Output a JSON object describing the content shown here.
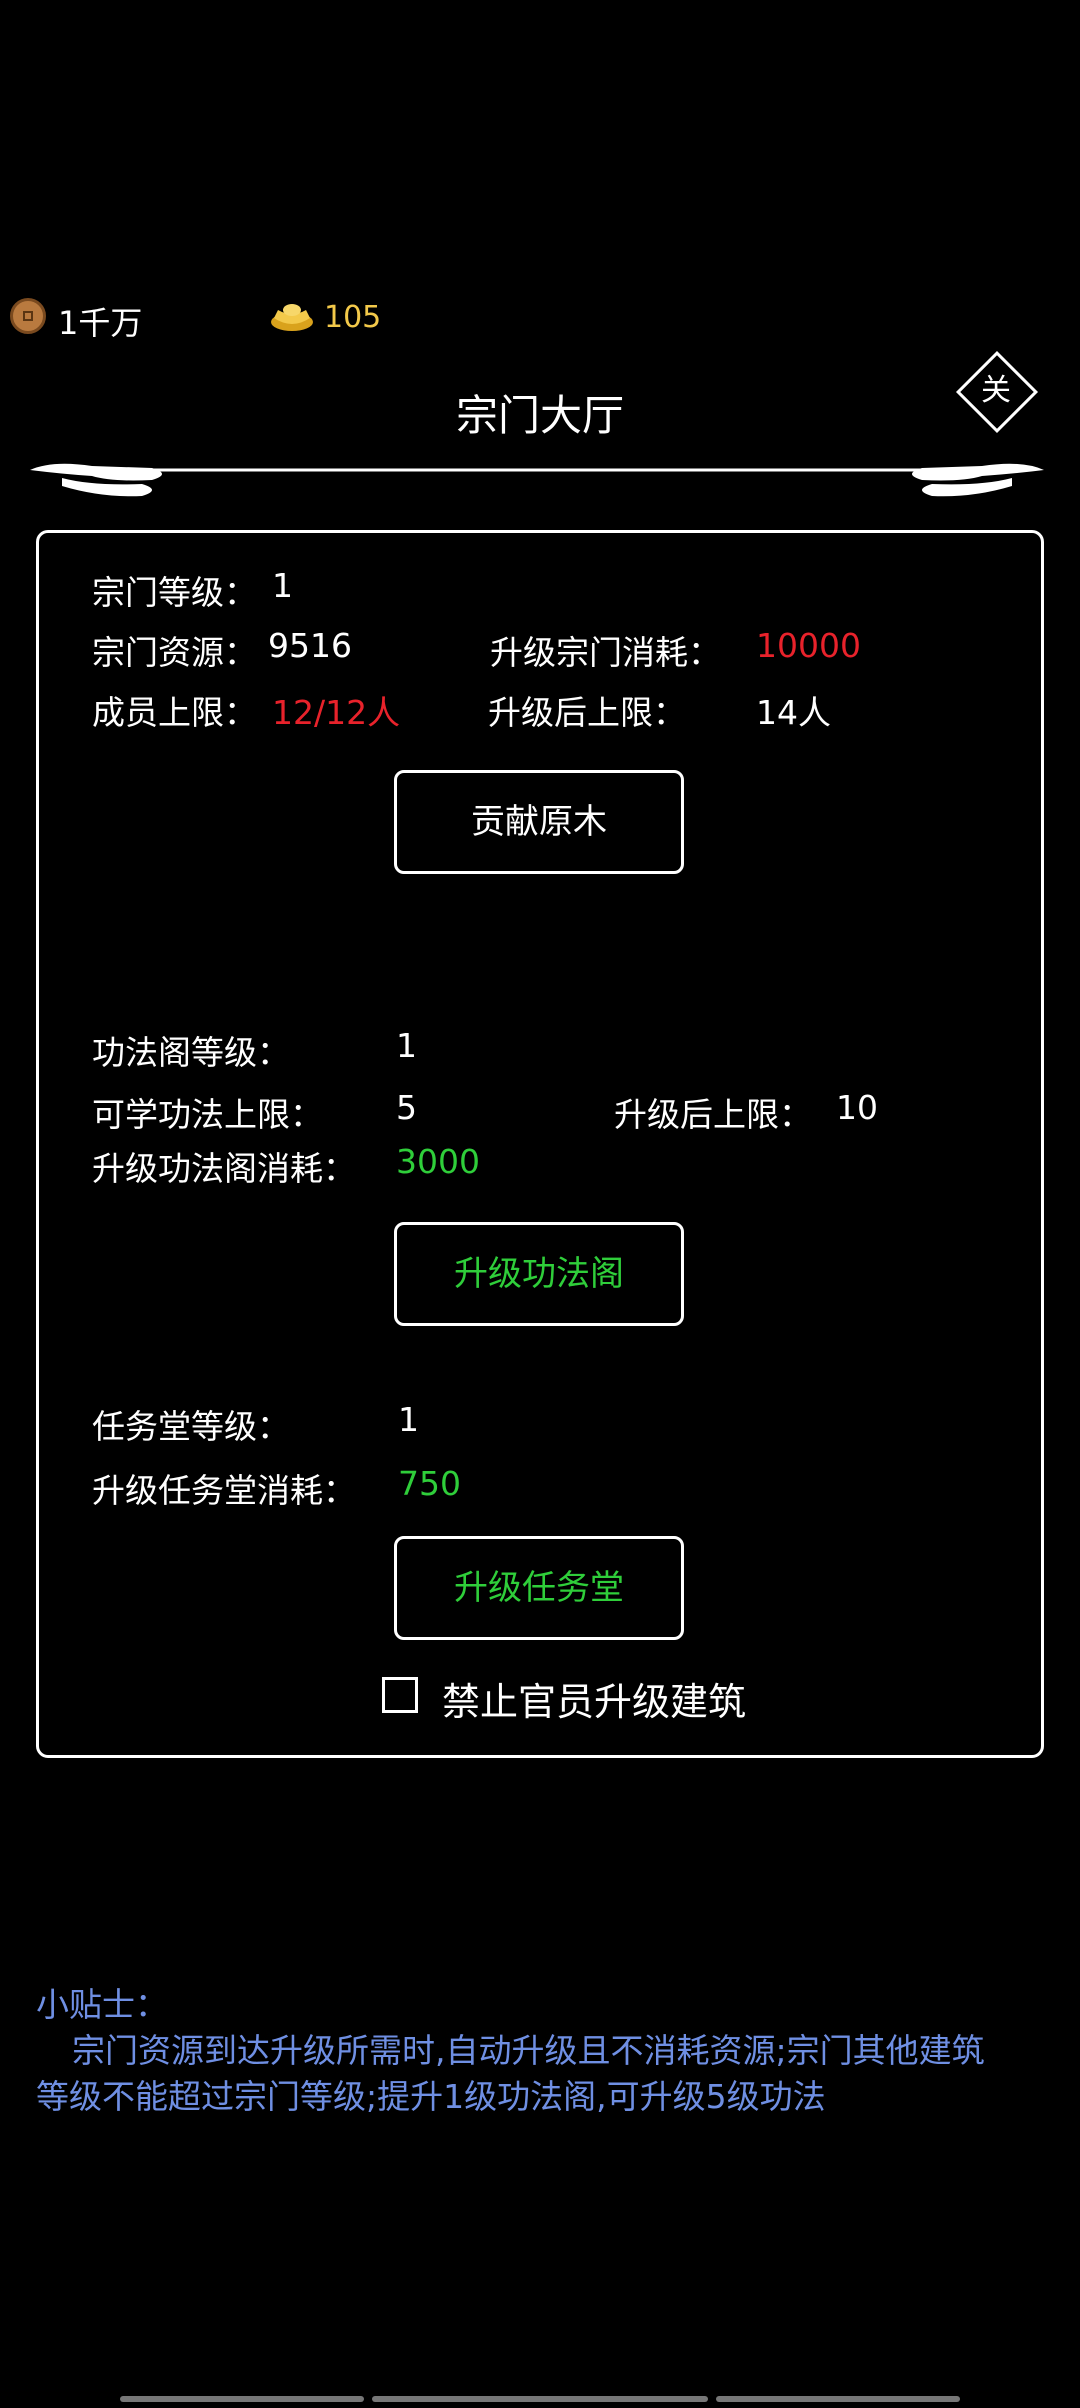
{
  "currency": {
    "coins": "1千万",
    "ingots": "105"
  },
  "header": {
    "title": "宗门大厅",
    "close_label": "关"
  },
  "sect": {
    "level_label": "宗门等级：",
    "level_value": "1",
    "resource_label": "宗门资源：",
    "resource_value": "9516",
    "upgrade_cost_label": "升级宗门消耗：",
    "upgrade_cost_value": "10000",
    "member_limit_label": "成员上限：",
    "member_limit_value": "12/12人",
    "after_upgrade_limit_label": "升级后上限：",
    "after_upgrade_limit_value": "14人",
    "contribute_button": "贡献原木"
  },
  "skill_pavilion": {
    "level_label": "功法阁等级：",
    "level_value": "1",
    "learn_limit_label": "可学功法上限：",
    "learn_limit_value": "5",
    "after_upgrade_label": "升级后上限：",
    "after_upgrade_value": "10",
    "cost_label": "升级功法阁消耗：",
    "cost_value": "3000",
    "upgrade_button": "升级功法阁"
  },
  "mission_hall": {
    "level_label": "任务堂等级：",
    "level_value": "1",
    "cost_label": "升级任务堂消耗：",
    "cost_value": "750",
    "upgrade_button": "升级任务堂"
  },
  "option": {
    "forbid_officials_label": "禁止官员升级建筑",
    "checked": false
  },
  "tips": {
    "heading": "小贴士：",
    "text": "宗门资源到达升级所需时,自动升级且不消耗资源;宗门其他建筑等级不能超过宗门等级;提升1级功法阁,可升级5级功法"
  },
  "colors": {
    "warning": "#e8222b",
    "affordable": "#2fce3a",
    "gold": "#f3c94a",
    "tip": "#6f8fe3"
  }
}
